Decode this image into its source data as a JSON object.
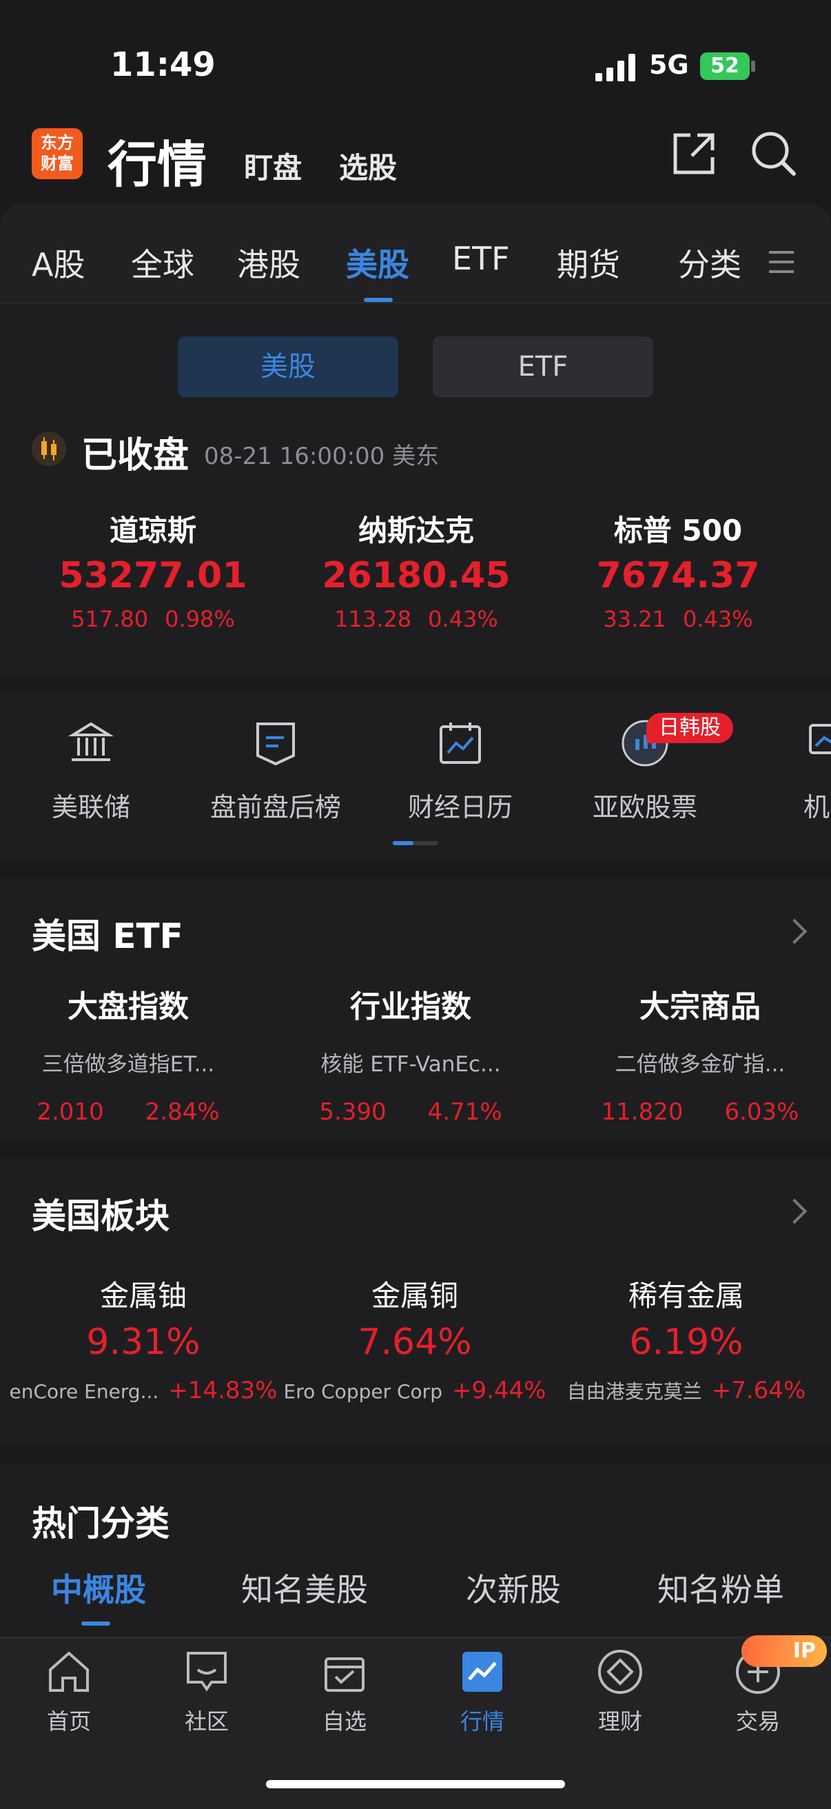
{
  "status": {
    "time": "11:49",
    "network": "5G",
    "battery": "52"
  },
  "header": {
    "logo_line1": "东方",
    "logo_line2": "财富",
    "title": "行情",
    "link1": "盯盘",
    "link2": "选股"
  },
  "tabs": [
    "A股",
    "全球",
    "港股",
    "美股",
    "ETF",
    "期货",
    "分类"
  ],
  "segments": [
    "美股",
    "ETF"
  ],
  "market": {
    "state": "已收盘",
    "time": "08-21 16:00:00 美东"
  },
  "indices": [
    {
      "name": "道琼斯",
      "value": "53277.01",
      "change": "517.80",
      "pct": "0.98%"
    },
    {
      "name": "纳斯达克",
      "value": "26180.45",
      "change": "113.28",
      "pct": "0.43%"
    },
    {
      "name": "标普 500",
      "value": "7674.37",
      "change": "33.21",
      "pct": "0.43%"
    }
  ],
  "quick": [
    "美联储",
    "盘前盘后榜",
    "财经日历",
    "亚欧股票",
    "机构"
  ],
  "quick_badge": "日韩股",
  "etf_section": {
    "title": "美国 ETF",
    "cols": [
      {
        "name": "大盘指数",
        "sub": "三倍做多道指ET...",
        "price": "2.010",
        "pct": "2.84%"
      },
      {
        "name": "行业指数",
        "sub": "核能 ETF-VanEc...",
        "price": "5.390",
        "pct": "4.71%"
      },
      {
        "name": "大宗商品",
        "sub": "二倍做多金矿指...",
        "price": "11.820",
        "pct": "6.03%"
      }
    ]
  },
  "block_section": {
    "title": "美国板块",
    "cols": [
      {
        "name": "金属铀",
        "pct": "9.31%",
        "stock": "enCore Energ...",
        "stock_pct": "+14.83%"
      },
      {
        "name": "金属铜",
        "pct": "7.64%",
        "stock": "Ero Copper Corp",
        "stock_pct": "+9.44%"
      },
      {
        "name": "稀有金属",
        "pct": "6.19%",
        "stock": "自由港麦克莫兰",
        "stock_pct": "+7.64%"
      }
    ]
  },
  "hot": {
    "title": "热门分类",
    "tabs": [
      "中概股",
      "知名美股",
      "次新股",
      "知名粉单"
    ]
  },
  "bottom_nav": [
    "首页",
    "社区",
    "自选",
    "行情",
    "理财",
    "交易"
  ],
  "ip_badge": "IP",
  "colors": {
    "accent": "#3b86e0",
    "up": "#e5202b",
    "brand": "#f25a1e"
  }
}
